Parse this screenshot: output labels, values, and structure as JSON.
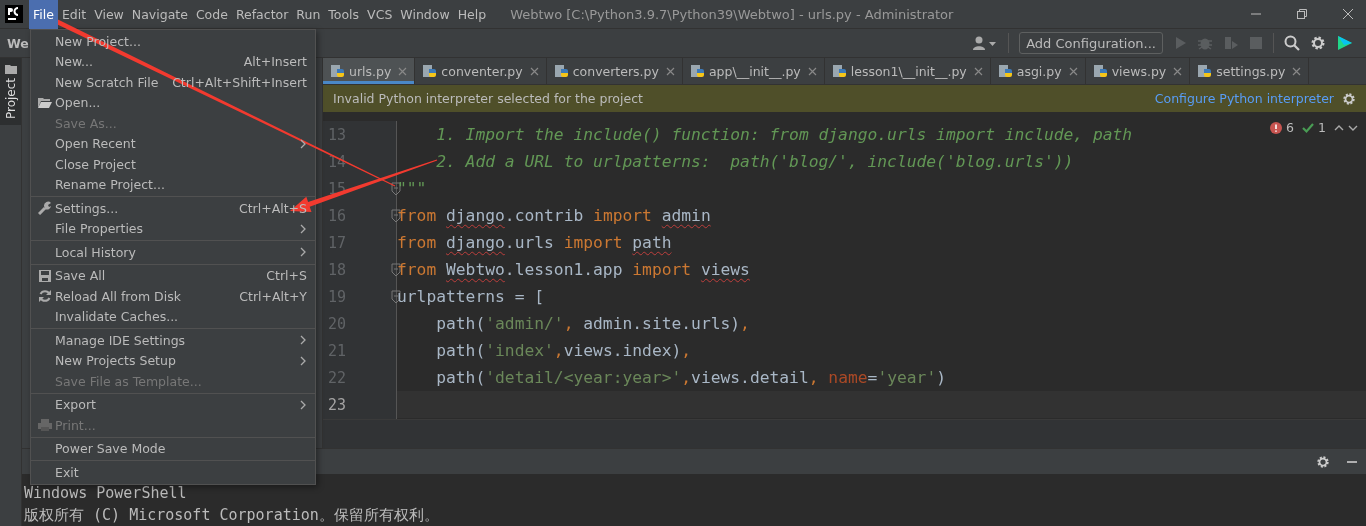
{
  "menu_bar": [
    {
      "label": "File",
      "selected": true
    },
    {
      "label": "Edit",
      "selected": false
    },
    {
      "label": "View",
      "selected": false
    },
    {
      "label": "Navigate",
      "selected": false
    },
    {
      "label": "Code",
      "selected": false
    },
    {
      "label": "Refactor",
      "selected": false
    },
    {
      "label": "Run",
      "selected": false
    },
    {
      "label": "Tools",
      "selected": false
    },
    {
      "label": "VCS",
      "selected": false
    },
    {
      "label": "Window",
      "selected": false
    },
    {
      "label": "Help",
      "selected": false
    }
  ],
  "window": {
    "title": "Webtwo [C:\\Python3.9.7\\Python39\\Webtwo] - urls.py - Administrator"
  },
  "toolbar": {
    "project": "We",
    "run_configuration": "Add Configuration..."
  },
  "side_tab": "Project",
  "tabs": [
    {
      "label": "urls.py",
      "selected": true
    },
    {
      "label": "conventer.py",
      "selected": false
    },
    {
      "label": "converters.py",
      "selected": false
    },
    {
      "label": "app\\__init__.py",
      "selected": false
    },
    {
      "label": "lesson1\\__init__.py",
      "selected": false
    },
    {
      "label": "asgi.py",
      "selected": false
    },
    {
      "label": "views.py",
      "selected": false
    },
    {
      "label": "settings.py",
      "selected": false
    }
  ],
  "notification": {
    "message": "Invalid Python interpreter selected for the project",
    "link": "Configure Python interpreter"
  },
  "inspections": {
    "errors": "6",
    "ok": "1"
  },
  "code_lines": [
    {
      "number": "13",
      "fold": false,
      "current": false,
      "tokens": [
        {
          "kind": "docstring",
          "text": "    1. Import the include() function: from django.urls import include, path",
          "warn": false
        }
      ]
    },
    {
      "number": "14",
      "fold": false,
      "current": false,
      "tokens": [
        {
          "kind": "docstring",
          "text": "    2. Add a URL to urlpatterns:  path('blog/', include('blog.urls'))",
          "warn": false
        }
      ]
    },
    {
      "number": "15",
      "fold": true,
      "current": false,
      "tokens": [
        {
          "kind": "docstring",
          "text": "\"\"\"",
          "warn": false
        }
      ]
    },
    {
      "number": "16",
      "fold": true,
      "current": false,
      "tokens": [
        {
          "kind": "keyword",
          "text": "from ",
          "warn": false
        },
        {
          "kind": "plain",
          "text": "django",
          "warn": true
        },
        {
          "kind": "plain",
          "text": ".contrib ",
          "warn": false
        },
        {
          "kind": "keyword",
          "text": "import ",
          "warn": false
        },
        {
          "kind": "plain",
          "text": "admin",
          "warn": true
        }
      ]
    },
    {
      "number": "17",
      "fold": false,
      "current": false,
      "tokens": [
        {
          "kind": "keyword",
          "text": "from ",
          "warn": false
        },
        {
          "kind": "plain",
          "text": "django",
          "warn": true
        },
        {
          "kind": "plain",
          "text": ".urls ",
          "warn": false
        },
        {
          "kind": "keyword",
          "text": "import ",
          "warn": false
        },
        {
          "kind": "plain",
          "text": "path",
          "warn": true
        }
      ]
    },
    {
      "number": "18",
      "fold": true,
      "current": false,
      "tokens": [
        {
          "kind": "keyword",
          "text": "from ",
          "warn": false
        },
        {
          "kind": "plain",
          "text": "Webtwo",
          "warn": true
        },
        {
          "kind": "plain",
          "text": ".lesson1.app ",
          "warn": false
        },
        {
          "kind": "keyword",
          "text": "import ",
          "warn": false
        },
        {
          "kind": "plain",
          "text": "views",
          "warn": true
        }
      ]
    },
    {
      "number": "19",
      "fold": true,
      "current": false,
      "tokens": [
        {
          "kind": "plain",
          "text": "urlpatterns = [",
          "warn": false
        }
      ]
    },
    {
      "number": "20",
      "fold": false,
      "current": false,
      "tokens": [
        {
          "kind": "plain",
          "text": "    path(",
          "warn": false
        },
        {
          "kind": "string",
          "text": "'admin/'",
          "warn": false
        },
        {
          "kind": "keyword",
          "text": ", ",
          "warn": false
        },
        {
          "kind": "plain",
          "text": "admin.site.urls)",
          "warn": false
        },
        {
          "kind": "keyword",
          "text": ",",
          "warn": false
        }
      ]
    },
    {
      "number": "21",
      "fold": false,
      "current": false,
      "tokens": [
        {
          "kind": "plain",
          "text": "    path(",
          "warn": false
        },
        {
          "kind": "string",
          "text": "'index'",
          "warn": false
        },
        {
          "kind": "keyword",
          "text": ",",
          "warn": false
        },
        {
          "kind": "plain",
          "text": "views.index)",
          "warn": false
        },
        {
          "kind": "keyword",
          "text": ",",
          "warn": false
        }
      ]
    },
    {
      "number": "22",
      "fold": false,
      "current": false,
      "tokens": [
        {
          "kind": "plain",
          "text": "    path(",
          "warn": false
        },
        {
          "kind": "string",
          "text": "'detail/<year:year>'",
          "warn": false
        },
        {
          "kind": "keyword",
          "text": ",",
          "warn": false
        },
        {
          "kind": "plain",
          "text": "views.detail",
          "warn": false
        },
        {
          "kind": "keyword",
          "text": ", ",
          "warn": false
        },
        {
          "kind": "param",
          "text": "name",
          "warn": false
        },
        {
          "kind": "plain",
          "text": "=",
          "warn": false
        },
        {
          "kind": "string",
          "text": "'year'",
          "warn": false
        },
        {
          "kind": "plain",
          "text": ")",
          "warn": false
        }
      ]
    },
    {
      "number": "23",
      "fold": false,
      "current": true
    }
  ],
  "terminal": [
    "Windows PowerShell",
    "版权所有 (C) Microsoft Corporation。保留所有权利。"
  ],
  "file_menu": [
    {
      "kind": "item",
      "label": "New Project...",
      "disabled": false,
      "submenu": false
    },
    {
      "kind": "item",
      "label": "New...",
      "shortcut": "Alt+Insert",
      "disabled": false,
      "submenu": false
    },
    {
      "kind": "item",
      "label": "New Scratch File",
      "shortcut": "Ctrl+Alt+Shift+Insert",
      "disabled": false,
      "submenu": false
    },
    {
      "kind": "item",
      "label": "Open...",
      "disabled": false,
      "submenu": false
    },
    {
      "kind": "item",
      "label": "Save As...",
      "disabled": true,
      "submenu": false
    },
    {
      "kind": "item",
      "label": "Open Recent",
      "disabled": false,
      "submenu": true
    },
    {
      "kind": "item",
      "label": "Close Project",
      "disabled": false,
      "submenu": false
    },
    {
      "kind": "item",
      "label": "Rename Project...",
      "disabled": false,
      "submenu": false
    },
    {
      "kind": "separator"
    },
    {
      "kind": "item",
      "label": "Settings...",
      "shortcut": "Ctrl+Alt+S",
      "disabled": false,
      "submenu": false
    },
    {
      "kind": "item",
      "label": "File Properties",
      "disabled": false,
      "submenu": true
    },
    {
      "kind": "separator"
    },
    {
      "kind": "item",
      "label": "Local History",
      "disabled": false,
      "submenu": true
    },
    {
      "kind": "separator"
    },
    {
      "kind": "item",
      "label": "Save All",
      "shortcut": "Ctrl+S",
      "disabled": false,
      "submenu": false
    },
    {
      "kind": "item",
      "label": "Reload All from Disk",
      "shortcut": "Ctrl+Alt+Y",
      "disabled": false,
      "submenu": false
    },
    {
      "kind": "item",
      "label": "Invalidate Caches...",
      "disabled": false,
      "submenu": false
    },
    {
      "kind": "separator"
    },
    {
      "kind": "item",
      "label": "Manage IDE Settings",
      "disabled": false,
      "submenu": true
    },
    {
      "kind": "item",
      "label": "New Projects Setup",
      "disabled": false,
      "submenu": true
    },
    {
      "kind": "item",
      "label": "Save File as Template...",
      "disabled": true,
      "submenu": false
    },
    {
      "kind": "separator"
    },
    {
      "kind": "item",
      "label": "Export",
      "disabled": false,
      "submenu": true
    },
    {
      "kind": "item",
      "label": "Print...",
      "disabled": true,
      "submenu": false
    },
    {
      "kind": "separator"
    },
    {
      "kind": "item",
      "label": "Power Save Mode",
      "disabled": false,
      "submenu": false
    },
    {
      "kind": "separator"
    },
    {
      "kind": "item",
      "label": "Exit",
      "disabled": false,
      "submenu": false
    }
  ]
}
